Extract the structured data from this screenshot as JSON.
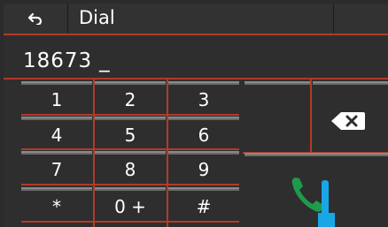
{
  "header": {
    "title": "Dial"
  },
  "display": {
    "number": "18673",
    "cursor": "_"
  },
  "keypad": {
    "rows": [
      [
        "1",
        "2",
        "3"
      ],
      [
        "4",
        "5",
        "6"
      ],
      [
        "7",
        "8",
        "9"
      ],
      [
        "*",
        "0 +",
        "#"
      ]
    ]
  },
  "colors": {
    "accent": "#b23a2a",
    "call_green": "#1e9a4a",
    "pointer_blue": "#19a6e6"
  }
}
